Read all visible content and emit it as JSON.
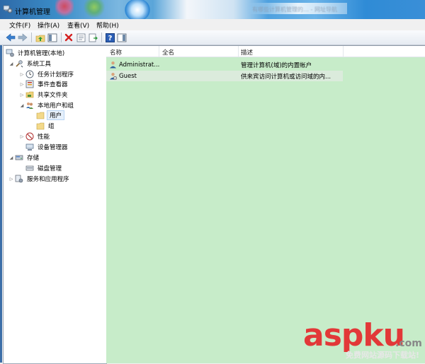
{
  "window": {
    "title": "计算机管理",
    "background_tab_text": "有哪些计算机管理的…  - 网址导航"
  },
  "menu": [
    "文件(F)",
    "操作(A)",
    "查看(V)",
    "帮助(H)"
  ],
  "toolbar": {
    "icons": [
      "back-arrow",
      "forward-arrow",
      "up-folder",
      "show-hide-tree",
      "delete",
      "properties",
      "export-list",
      "help",
      "show-hide-action-pane"
    ]
  },
  "tree": {
    "root": "计算机管理(本地)",
    "system_tools": "系统工具",
    "task_scheduler": "任务计划程序",
    "event_viewer": "事件查看器",
    "shared_folders": "共享文件夹",
    "local_users_groups": "本地用户和组",
    "users": "用户",
    "groups": "组",
    "performance": "性能",
    "device_manager": "设备管理器",
    "storage": "存储",
    "disk_management": "磁盘管理",
    "services_apps": "服务和应用程序"
  },
  "list": {
    "columns": [
      "名称",
      "全名",
      "描述"
    ],
    "rows": [
      {
        "name": "Administrat...",
        "full_name": "",
        "description": "管理计算机(域)的内置帐户"
      },
      {
        "name": "Guest",
        "full_name": "",
        "description": "供来宾访问计算机或访问域的内..."
      }
    ]
  },
  "watermark": {
    "brand": "aspku",
    "suffix": ".com",
    "caption": "免费网站源码下载站!"
  },
  "colors": {
    "list_background": "#c7ecc9",
    "selected_row": "#dbebdc",
    "watermark": "#e23838"
  }
}
